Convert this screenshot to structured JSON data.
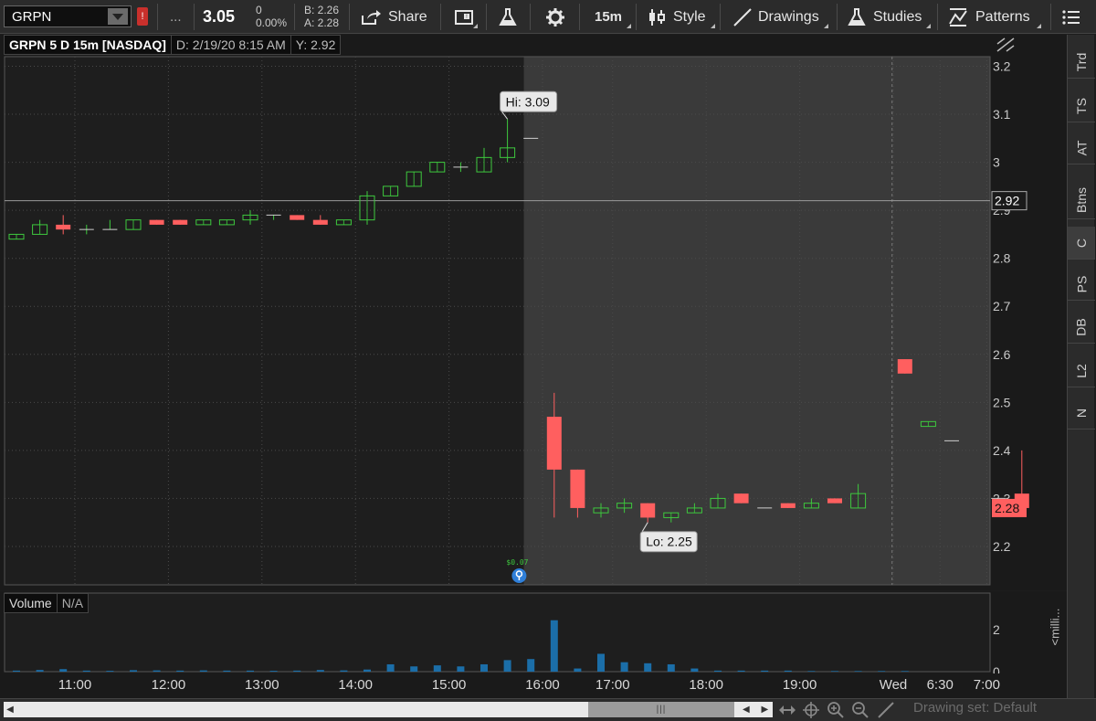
{
  "toolbar": {
    "symbol": "GRPN",
    "more_label": "...",
    "last_price": "3.05",
    "change": "0",
    "change_pct": "0.00%",
    "bid": "B: 2.26",
    "ask": "A: 2.28",
    "share_label": "Share",
    "timeframe_label": "15m",
    "style_label": "Style",
    "drawings_label": "Drawings",
    "studies_label": "Studies",
    "patterns_label": "Patterns",
    "alert_badge": "!"
  },
  "chart_header": {
    "symbol_desc": "GRPN 5 D 15m [NASDAQ]",
    "date": "D: 2/19/20 8:15 AM",
    "y": "Y: 2.92"
  },
  "volume_header": {
    "label": "Volume",
    "value": "N/A"
  },
  "sidebar_tabs": [
    "Trd",
    "TS",
    "AT",
    "Btns",
    "C",
    "PS",
    "DB",
    "L2",
    "N"
  ],
  "milli_label": "<milli...",
  "drawing_set_label": "Drawing set: Default",
  "colors": {
    "up": "#3ec93e",
    "down": "#ff5f5f",
    "regular_session_bg": "#1e1e1e",
    "extended_session_bg": "#3a3a3a",
    "volume_bar": "#1b6ea8",
    "cursor_marker": "#2f7fd9",
    "earnings_text": "#3ec93e"
  },
  "chart_data": {
    "type": "candlestick",
    "title": "GRPN 5 D 15m [NASDAQ]",
    "y_ticks": [
      2.2,
      2.3,
      2.4,
      2.5,
      2.6,
      2.7,
      2.8,
      2.9,
      3,
      3.1,
      3.2
    ],
    "y_tick_labels": [
      "2.2",
      "2.3",
      "2.4",
      "2.5",
      "2.6",
      "2.7",
      "2.8",
      "2.9",
      "3",
      "3.1",
      "3.2"
    ],
    "ylim": [
      2.12,
      3.22
    ],
    "x_tick_labels": [
      {
        "label": "11:00",
        "index": 2.5
      },
      {
        "label": "12:00",
        "index": 6.5
      },
      {
        "label": "13:00",
        "index": 10.5
      },
      {
        "label": "14:00",
        "index": 14.5
      },
      {
        "label": "15:00",
        "index": 18.5
      },
      {
        "label": "16:00",
        "index": 22.5
      },
      {
        "label": "17:00",
        "index": 25.5
      },
      {
        "label": "18:00",
        "index": 29.5
      },
      {
        "label": "19:00",
        "index": 33.5
      },
      {
        "label": "Wed",
        "index": 37.5
      },
      {
        "label": "6:30",
        "index": 39.5
      },
      {
        "label": "7:00",
        "index": 41.5
      }
    ],
    "day_separator_indices": [
      37.45
    ],
    "session_break_index": 21.7,
    "candles": [
      {
        "o": 2.84,
        "h": 2.85,
        "l": 2.84,
        "c": 2.85
      },
      {
        "o": 2.85,
        "h": 2.88,
        "l": 2.85,
        "c": 2.87
      },
      {
        "o": 2.87,
        "h": 2.89,
        "l": 2.85,
        "c": 2.86
      },
      {
        "o": 2.86,
        "h": 2.87,
        "l": 2.85,
        "c": 2.86
      },
      {
        "o": 2.86,
        "h": 2.88,
        "l": 2.86,
        "c": 2.86
      },
      {
        "o": 2.86,
        "h": 2.88,
        "l": 2.86,
        "c": 2.88
      },
      {
        "o": 2.88,
        "h": 2.88,
        "l": 2.87,
        "c": 2.87
      },
      {
        "o": 2.88,
        "h": 2.88,
        "l": 2.87,
        "c": 2.87
      },
      {
        "o": 2.87,
        "h": 2.88,
        "l": 2.87,
        "c": 2.88
      },
      {
        "o": 2.87,
        "h": 2.88,
        "l": 2.87,
        "c": 2.88
      },
      {
        "o": 2.88,
        "h": 2.9,
        "l": 2.87,
        "c": 2.89
      },
      {
        "o": 2.89,
        "h": 2.89,
        "l": 2.88,
        "c": 2.89
      },
      {
        "o": 2.89,
        "h": 2.89,
        "l": 2.88,
        "c": 2.88
      },
      {
        "o": 2.88,
        "h": 2.89,
        "l": 2.87,
        "c": 2.87
      },
      {
        "o": 2.87,
        "h": 2.88,
        "l": 2.87,
        "c": 2.88
      },
      {
        "o": 2.88,
        "h": 2.94,
        "l": 2.87,
        "c": 2.93
      },
      {
        "o": 2.93,
        "h": 2.95,
        "l": 2.93,
        "c": 2.95
      },
      {
        "o": 2.95,
        "h": 2.98,
        "l": 2.95,
        "c": 2.98
      },
      {
        "o": 2.98,
        "h": 3.0,
        "l": 2.98,
        "c": 3.0
      },
      {
        "o": 2.99,
        "h": 3.0,
        "l": 2.98,
        "c": 2.99
      },
      {
        "o": 2.98,
        "h": 3.03,
        "l": 2.98,
        "c": 3.01
      },
      {
        "o": 3.01,
        "h": 3.09,
        "l": 3.0,
        "c": 3.03
      },
      {
        "o": 3.05,
        "h": 3.05,
        "l": 3.05,
        "c": 3.05
      },
      {
        "o": 2.47,
        "h": 2.52,
        "l": 2.26,
        "c": 2.36
      },
      {
        "o": 2.36,
        "h": 2.36,
        "l": 2.26,
        "c": 2.28
      },
      {
        "o": 2.27,
        "h": 2.29,
        "l": 2.26,
        "c": 2.28
      },
      {
        "o": 2.28,
        "h": 2.3,
        "l": 2.27,
        "c": 2.29
      },
      {
        "o": 2.29,
        "h": 2.29,
        "l": 2.25,
        "c": 2.26
      },
      {
        "o": 2.26,
        "h": 2.27,
        "l": 2.25,
        "c": 2.27
      },
      {
        "o": 2.27,
        "h": 2.29,
        "l": 2.27,
        "c": 2.28
      },
      {
        "o": 2.28,
        "h": 2.31,
        "l": 2.28,
        "c": 2.3
      },
      {
        "o": 2.31,
        "h": 2.31,
        "l": 2.29,
        "c": 2.29
      },
      {
        "o": 2.28,
        "h": 2.28,
        "l": 2.28,
        "c": 2.28
      },
      {
        "o": 2.29,
        "h": 2.29,
        "l": 2.28,
        "c": 2.28
      },
      {
        "o": 2.28,
        "h": 2.3,
        "l": 2.28,
        "c": 2.29
      },
      {
        "o": 2.3,
        "h": 2.3,
        "l": 2.29,
        "c": 2.29
      },
      {
        "o": 2.28,
        "h": 2.33,
        "l": 2.28,
        "c": 2.31
      },
      null,
      {
        "o": 2.59,
        "h": 2.59,
        "l": 2.56,
        "c": 2.56
      },
      {
        "o": 2.45,
        "h": 2.46,
        "l": 2.45,
        "c": 2.46
      },
      {
        "o": 2.42,
        "h": 2.42,
        "l": 2.42,
        "c": 2.42
      },
      null,
      {
        "o": 2.3,
        "h": 2.3,
        "l": 2.3,
        "c": 2.3
      },
      {
        "o": 2.31,
        "h": 2.4,
        "l": 2.27,
        "c": 2.28
      }
    ],
    "volume": {
      "y_tick_labels": [
        "2",
        "0"
      ],
      "y_ticks": [
        2,
        0
      ],
      "ylim": [
        0,
        2.7
      ],
      "values": [
        0.05,
        0.08,
        0.12,
        0.05,
        0.04,
        0.07,
        0.06,
        0.05,
        0.06,
        0.05,
        0.05,
        0.04,
        0.05,
        0.08,
        0.06,
        0.1,
        0.35,
        0.25,
        0.3,
        0.25,
        0.35,
        0.55,
        0.6,
        2.45,
        0.15,
        0.85,
        0.45,
        0.4,
        0.35,
        0.15,
        0.05,
        0.05,
        0.05,
        0.05,
        0.03,
        0.03,
        0.03,
        0.03,
        0.03,
        0,
        0,
        0,
        0,
        0,
        0
      ]
    },
    "annotations": {
      "hi_label": "Hi: 3.09",
      "hi_index": 21,
      "lo_label": "Lo: 2.25",
      "lo_index": 27,
      "crosshair_price": 2.92,
      "crosshair_label": "2.92",
      "last_price": 2.28,
      "last_label": "2.28",
      "earnings_label": "$0.07",
      "earnings_index": 21.5
    }
  }
}
